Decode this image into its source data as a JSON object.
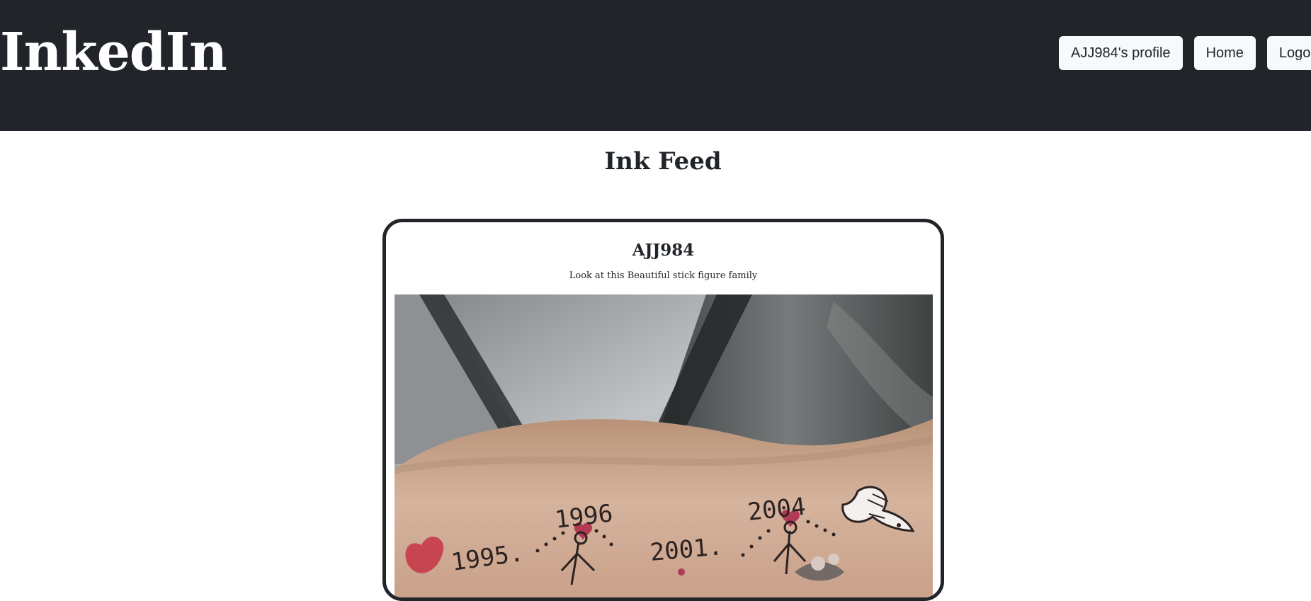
{
  "header": {
    "brand": "InkedIn",
    "nav": {
      "profile_label": "AJJ984's profile",
      "home_label": "Home",
      "logout_label": "Logout"
    },
    "colors": {
      "navbar_bg": "#212529",
      "nav_button_bg": "#f8f9fa"
    }
  },
  "feed": {
    "title": "Ink Feed",
    "posts": [
      {
        "username": "AJJ984",
        "caption": "Look at this Beautiful stick figure family",
        "image": {
          "description_icon": "tattoo-photo",
          "visible_text": [
            "1995",
            "1996",
            "2001",
            "2004"
          ]
        }
      }
    ]
  }
}
